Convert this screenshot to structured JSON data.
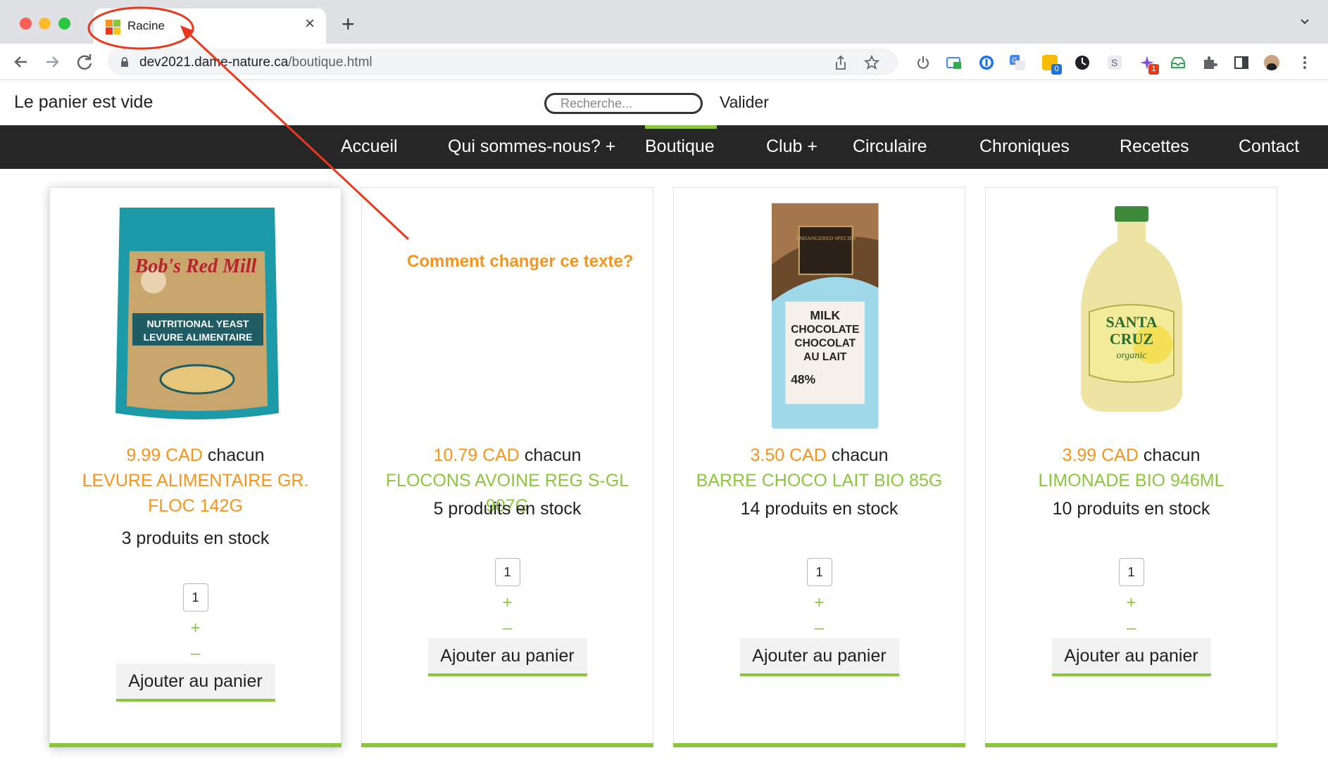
{
  "browser": {
    "tab_title": "Racine",
    "tab_close": "×",
    "new_tab": "+",
    "url_host": "dev2021.dame-nature.ca",
    "url_path": "/boutique.html",
    "extension_badges": {
      "blue_ext": "0",
      "red_ext": "1"
    }
  },
  "site": {
    "cart_status": "Le panier est vide",
    "search_placeholder": "Recherche...",
    "search_submit": "Valider",
    "menu": [
      {
        "label": "Accueil"
      },
      {
        "label": "Qui sommes-nous? +"
      },
      {
        "label": "Boutique",
        "active": true
      },
      {
        "label": "Club +"
      },
      {
        "label": "Circulaire"
      },
      {
        "label": "Chroniques"
      },
      {
        "label": "Recettes"
      },
      {
        "label": "Contact"
      }
    ],
    "products": [
      {
        "price": "9.99 CAD",
        "unit": "chacun",
        "name": "LEVURE ALIMENTAIRE GR. FLOC 142G",
        "name_color": "#f7941d",
        "stock": "3 produits en stock",
        "qty": "1",
        "plus": "+",
        "minus": "–",
        "button": "Ajouter au panier",
        "image": "nutritional-yeast-bag",
        "image_text": [
          "Bob's Red Mill",
          "NUTRITIONAL YEAST",
          "LEVURE ALIMENTAIRE"
        ]
      },
      {
        "price": "10.79 CAD",
        "unit": "chacun",
        "name": "FLOCONS AVOINE REG S-GL 907G",
        "name_color": "#8cc63f",
        "stock": "5 produits en stock",
        "qty": "1",
        "plus": "+",
        "minus": "–",
        "button": "Ajouter au panier",
        "image": "none"
      },
      {
        "price": "3.50 CAD",
        "unit": "chacun",
        "name": "BARRE CHOCO LAIT BIO 85G",
        "name_color": "#8cc63f",
        "stock": "14 produits en stock",
        "qty": "1",
        "plus": "+",
        "minus": "–",
        "button": "Ajouter au panier",
        "image": "chocolate-bar",
        "image_text": [
          "ENDANGERED SPECIES",
          "MILK",
          "CHOCOLATE",
          "CHOCOLAT",
          "AU LAIT",
          "48%"
        ]
      },
      {
        "price": "3.99 CAD",
        "unit": "chacun",
        "name": "LIMONADE BIO 946ML",
        "name_color": "#8cc63f",
        "stock": "10 produits en stock",
        "qty": "1",
        "plus": "+",
        "minus": "–",
        "button": "Ajouter au panier",
        "image": "lemonade-bottle",
        "image_text": [
          "SANTA",
          "CRUZ",
          "organic"
        ]
      }
    ]
  },
  "annotation": {
    "text": "Comment changer ce texte?",
    "color": "#f7941d",
    "stroke_color": "#e8391f"
  },
  "colors": {
    "accent_green": "#8cc63f",
    "price_orange": "#f7941d",
    "menubar": "#262626"
  }
}
